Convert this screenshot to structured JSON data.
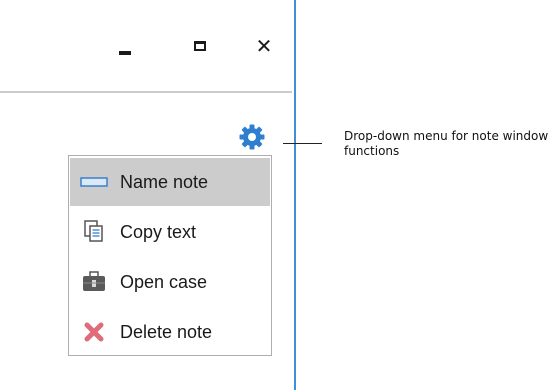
{
  "window": {
    "controls": {
      "minimize_icon": "minimize-icon",
      "maximize_icon": "maximize-icon",
      "close_icon": "close-icon",
      "close_glyph": "✕"
    },
    "accent_color": "#3f8fd6"
  },
  "gear": {
    "icon": "gear-icon",
    "color": "#2f7fd0"
  },
  "menu": {
    "items": [
      {
        "label": "Name note",
        "icon": "rename-icon",
        "selected": true
      },
      {
        "label": "Copy text",
        "icon": "copy-icon",
        "selected": false
      },
      {
        "label": "Open case",
        "icon": "case-icon",
        "selected": false
      },
      {
        "label": "Delete note",
        "icon": "delete-icon",
        "selected": false
      }
    ],
    "selected_bg": "#cccccc"
  },
  "callout": {
    "text": "Drop-down menu for note window functions"
  }
}
